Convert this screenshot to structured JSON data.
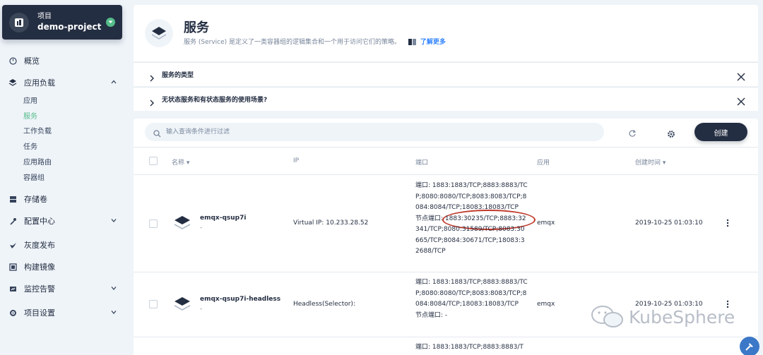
{
  "project": {
    "label": "项目",
    "name": "demo-project"
  },
  "nav": {
    "overview": "概览",
    "app_workloads": "应用负载",
    "sub": [
      "应用",
      "服务",
      "工作负载",
      "任务",
      "应用路由",
      "容器组"
    ],
    "storage": "存储卷",
    "config": "配置中心",
    "grayscale": "灰度发布",
    "build_image": "构建镜像",
    "monitoring": "监控告警",
    "settings": "项目设置"
  },
  "header": {
    "title": "服务",
    "description": "服务 (Service) 是定义了一类容器组的逻辑集合和一个用于访问它们的策略。",
    "learn_more": "了解更多"
  },
  "faq": [
    "服务的类型",
    "无状态服务和有状态服务的使用场景?"
  ],
  "toolbar": {
    "search_placeholder": "输入查询条件进行过滤",
    "create": "创建"
  },
  "table": {
    "columns": [
      "名称",
      "IP",
      "端口",
      "应用",
      "创建时间"
    ],
    "rows": [
      {
        "name": "emqx-qsup7i",
        "desc": "-",
        "ip": "Virtual IP: ",
        "ip_value": "10.233.28.52",
        "ports": "端口: 1883:1883/TCP;8883:8883/TCP;8080:8080/TCP;8083:8083/TCP;8084:8084/TCP;18083:18083/TCP",
        "node_ports": "节点端口: 1883:30235/TCP;8883:32341/TCP;8080:31589/TCP;8083:30665/TCP;8084:30671/TCP;18083:32688/TCP",
        "app": "emqx",
        "created": "2019-10-25 01:03:10"
      },
      {
        "name": "emqx-qsup7i-headless",
        "desc": "-",
        "ip": "Headless(Selector):",
        "ports": "端口: 1883:1883/TCP;8883:8883/TCP;8080:8080/TCP;8083:8083/TCP;8084:8084/TCP;18083:18083/TCP",
        "node_ports": "节点端口: -",
        "app": "emqx",
        "created": "2019-10-25 01:03:10"
      },
      {
        "ports": "端口: 1883:1883/TCP;8883:8883/T"
      }
    ]
  },
  "watermark": "KubeSphere",
  "colors": {
    "sidebar_dark": "#242e42",
    "active_green": "#55bc8a",
    "link_blue": "#3385ff",
    "highlight_red": "#c0392b"
  }
}
